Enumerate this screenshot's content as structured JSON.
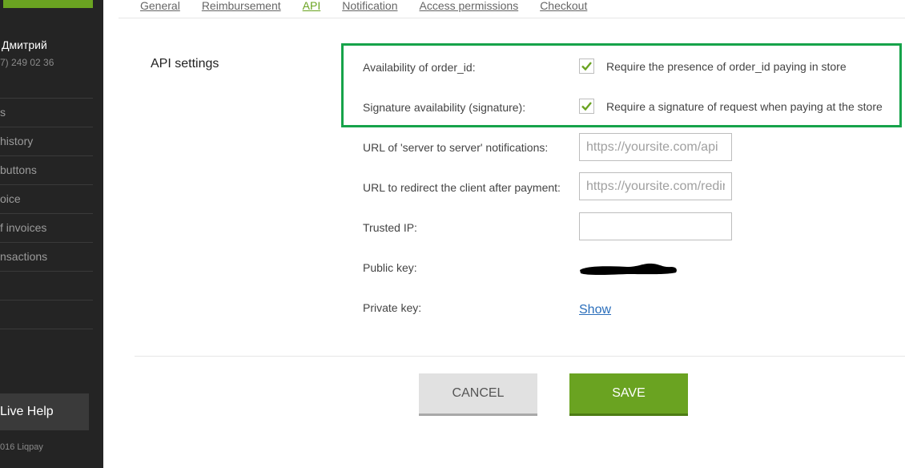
{
  "sidebar": {
    "user_name": "Дмитрий",
    "user_phone": "7) 249 02 36",
    "items": [
      {
        "label": "s"
      },
      {
        "label": "history"
      },
      {
        "label": "buttons"
      },
      {
        "label": "oice"
      },
      {
        "label": "f invoices"
      },
      {
        "label": "nsactions"
      },
      {
        "label": ""
      },
      {
        "label": ""
      }
    ],
    "live_help": "Live Help",
    "copyright": "016 Liqpay"
  },
  "tabs": [
    {
      "label": "General"
    },
    {
      "label": "Reimbursement"
    },
    {
      "label": "API",
      "active": true
    },
    {
      "label": "Notification"
    },
    {
      "label": "Access permissions"
    },
    {
      "label": "Checkout"
    }
  ],
  "section_title": "API settings",
  "settings": {
    "order_id": {
      "label": "Availability of order_id:",
      "checkbox_label": "Require the presence of order_id paying in store",
      "checked": true
    },
    "signature": {
      "label": "Signature availability (signature):",
      "checkbox_label": "Require a signature of request when paying at the store",
      "checked": true
    },
    "server_url": {
      "label": "URL of 'server to server' notifications:",
      "placeholder": "https://yoursite.com/api"
    },
    "redirect_url": {
      "label": "URL to redirect the client after payment:",
      "placeholder": "https://yoursite.com/redirect"
    },
    "trusted_ip": {
      "label": "Trusted IP:",
      "value": ""
    },
    "public_key": {
      "label": "Public key:"
    },
    "private_key": {
      "label": "Private key:",
      "show_link": "Show"
    }
  },
  "buttons": {
    "cancel": "CANCEL",
    "save": "SAVE"
  },
  "colors": {
    "accent": "#6aa321",
    "highlight": "#16a34a",
    "link": "#2a6ebb"
  }
}
